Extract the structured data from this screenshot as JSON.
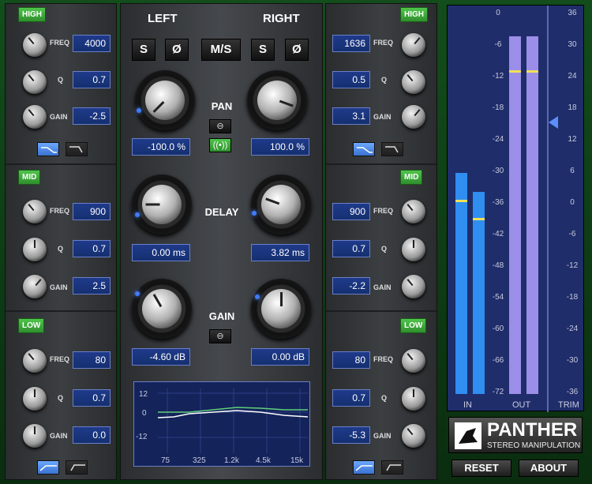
{
  "left_eq": {
    "high": {
      "tag": "HIGH",
      "freq": "4000",
      "q": "0.7",
      "gain": "-2.5"
    },
    "mid": {
      "tag": "MID",
      "freq": "900",
      "q": "0.7",
      "gain": "2.5"
    },
    "low": {
      "tag": "LOW",
      "freq": "80",
      "q": "0.7",
      "gain": "0.0"
    }
  },
  "right_eq": {
    "high": {
      "tag": "HIGH",
      "freq": "1636",
      "q": "0.5",
      "gain": "3.1"
    },
    "mid": {
      "tag": "MID",
      "freq": "900",
      "q": "0.7",
      "gain": "-2.2"
    },
    "low": {
      "tag": "LOW",
      "freq": "80",
      "q": "0.7",
      "gain": "-5.3"
    }
  },
  "labels": {
    "freq": "FREQ",
    "q": "Q",
    "gain": "GAIN"
  },
  "center": {
    "left_title": "LEFT",
    "right_title": "RIGHT",
    "buttons": {
      "s_left": "S",
      "phase_left": "Ø",
      "ms": "M/S",
      "s_right": "S",
      "phase_right": "Ø"
    },
    "pan": {
      "label": "PAN",
      "left": "-100.0 %",
      "right": "100.0 %"
    },
    "delay": {
      "label": "DELAY",
      "left": "0.00 ms",
      "right": "3.82 ms"
    },
    "gain": {
      "label": "GAIN",
      "left": "-4.60 dB",
      "right": "0.00 dB"
    }
  },
  "graph": {
    "y_ticks": [
      "12",
      "0",
      "-12"
    ],
    "x_ticks": [
      "75",
      "325",
      "1.2k",
      "4.5k",
      "15k"
    ]
  },
  "meters": {
    "scale_left": [
      "0",
      "-6",
      "-12",
      "-18",
      "-24",
      "-30",
      "-36",
      "-42",
      "-48",
      "-54",
      "-60",
      "-66",
      "-72"
    ],
    "scale_right": [
      "36",
      "30",
      "24",
      "18",
      "12",
      "6",
      "0",
      "-6",
      "-12",
      "-18",
      "-24",
      "-30",
      "-36"
    ],
    "labels": {
      "in": "IN",
      "out": "OUT",
      "trim": "TRIM"
    },
    "levels": {
      "in_l": 0.57,
      "in_r": 0.52,
      "out_l": 0.92,
      "out_r": 0.92
    },
    "trim_level": 0.7
  },
  "brand": {
    "name": "PANTHER",
    "subtitle": "STEREO MANIPULATION"
  },
  "footer": {
    "reset": "RESET",
    "about": "ABOUT"
  },
  "colors": {
    "accent_blue": "#3f7bff",
    "meter_bar": "#2f8ef0",
    "out_bar": "#9b8ee8",
    "green_tag": "#3fae3c"
  }
}
